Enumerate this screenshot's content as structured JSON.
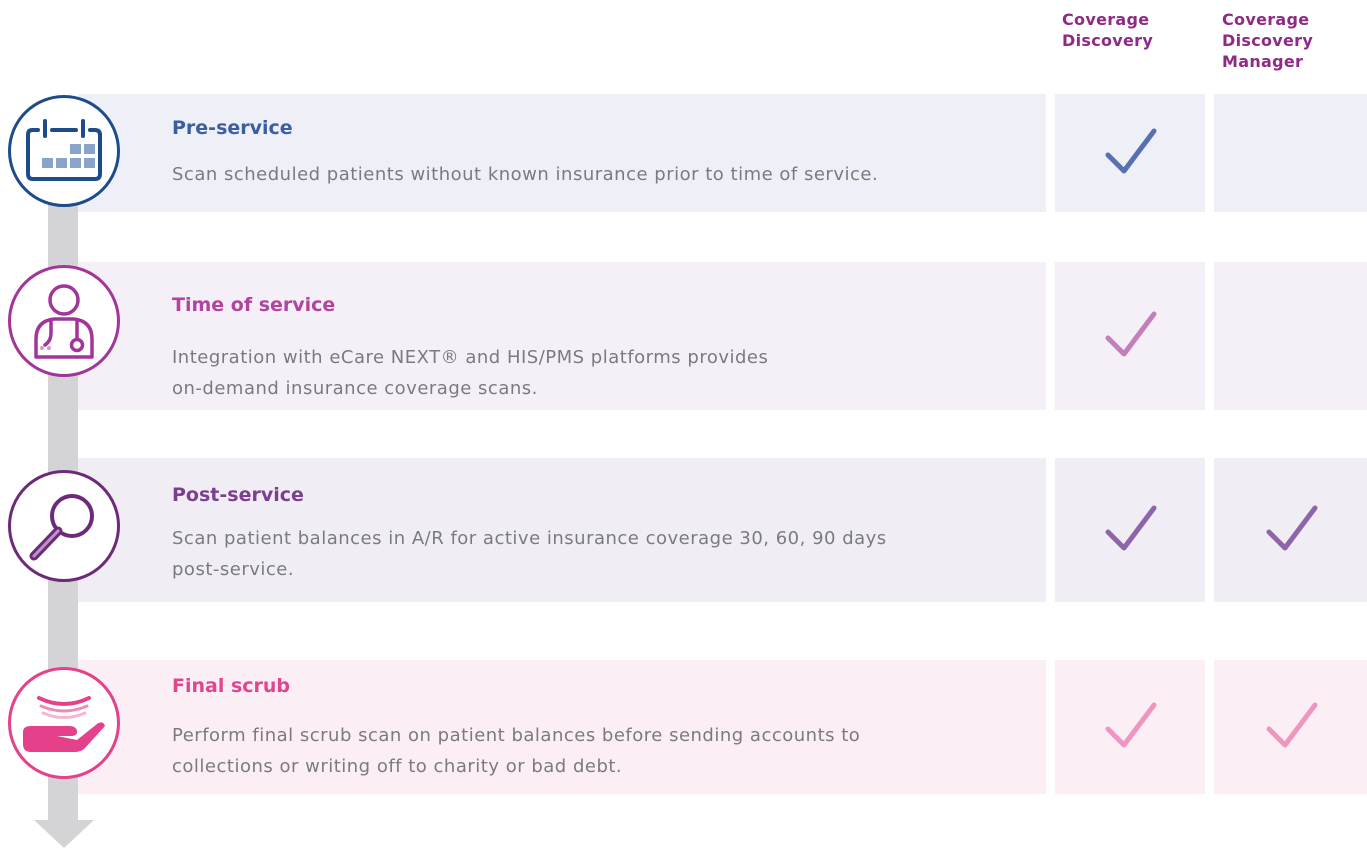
{
  "columns": [
    {
      "label": "Coverage\nDiscovery"
    },
    {
      "label": "Coverage\nDiscovery\nManager"
    }
  ],
  "steps": [
    {
      "title": "Pre-service",
      "description": "Scan scheduled patients without known insurance prior to time of service.",
      "icon": "calendar-icon",
      "accent": "#1e4b8a",
      "title_color": "#3b5ea3",
      "row_bg": "#efeff8",
      "check_color": "#5670b0",
      "coverage_discovery": true,
      "coverage_discovery_manager": false
    },
    {
      "title": "Time of service",
      "description": "Integration with eCare NEXT® and HIS/PMS platforms provides\non-demand insurance coverage scans.",
      "icon": "doctor-icon",
      "accent": "#a1359a",
      "title_color": "#b0449f",
      "row_bg": "#f5f0f7",
      "check_color": "#c27fb9",
      "coverage_discovery": true,
      "coverage_discovery_manager": false
    },
    {
      "title": "Post-service",
      "description": "Scan patient balances in A/R for active insurance coverage 30, 60, 90 days\npost-service.",
      "icon": "magnifier-icon",
      "accent": "#6e2a7a",
      "title_color": "#7b3f8e",
      "row_bg": "#f1edf5",
      "check_color": "#8e65a8",
      "coverage_discovery": true,
      "coverage_discovery_manager": true
    },
    {
      "title": "Final scrub",
      "description": "Perform final scrub scan on patient balances before sending accounts to\ncollections or writing off to charity or bad debt.",
      "icon": "hand-icon",
      "accent": "#e5418b",
      "title_color": "#e0468e",
      "row_bg": "#fbeef4",
      "check_color": "#ef96c0",
      "coverage_discovery": true,
      "coverage_discovery_manager": true
    }
  ]
}
